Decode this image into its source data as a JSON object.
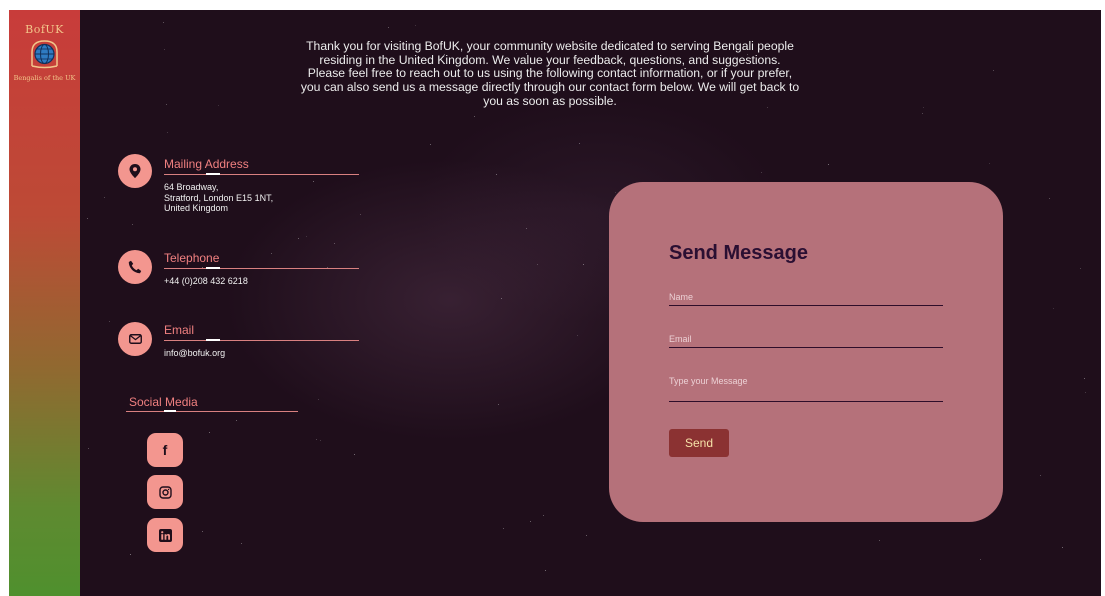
{
  "brand": {
    "name": "BofUK",
    "tagline": "Bengalis of the UK"
  },
  "intro": {
    "text": "Thank you for visiting BofUK, your community website dedicated to serving Bengali people residing in the United Kingdom. We value your feedback, questions, and suggestions. Please feel free to reach out to us using the following contact information, or if your prefer, you can also send us a message directly through our contact form below. We will get back to you as soon as possible."
  },
  "contacts": {
    "mailing": {
      "title": "Mailing Address",
      "line1": "64 Broadway,",
      "line2": "Stratford, London E15 1NT,",
      "line3": "United Kingdom",
      "icon": "map-pin-icon"
    },
    "telephone": {
      "title": "Telephone",
      "value": "+44 (0)208 432 6218",
      "icon": "phone-icon"
    },
    "email": {
      "title": "Email",
      "value": "info@bofuk.org",
      "icon": "envelope-icon"
    }
  },
  "social": {
    "title": "Social Media",
    "facebook_glyph": "f",
    "icons": [
      "facebook-icon",
      "instagram-icon",
      "linkedin-icon"
    ]
  },
  "form": {
    "title": "Send Message",
    "name_placeholder": "Name",
    "email_placeholder": "Email",
    "message_placeholder": "Type your Message",
    "send_label": "Send"
  },
  "colors": {
    "background": "#1f0e1b",
    "accent": "#f3968f",
    "card": "#b5717a",
    "send_button": "#8b3232",
    "heading": "#2a0f32"
  }
}
